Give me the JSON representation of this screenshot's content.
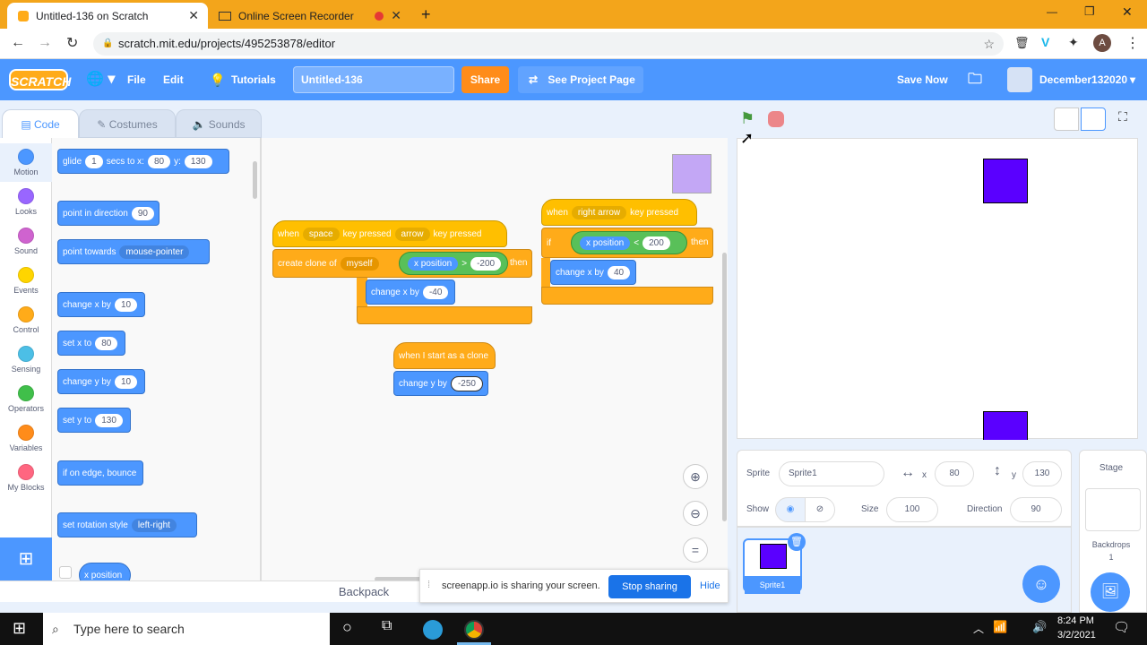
{
  "browser": {
    "tabs": [
      {
        "label": "Untitled-136 on Scratch"
      },
      {
        "label": "Online Screen Recorder"
      }
    ],
    "url": "scratch.mit.edu/projects/495253878/editor",
    "profile_initial": "A"
  },
  "menu": {
    "logo": "SCRATCH",
    "file": "File",
    "edit": "Edit",
    "tutorials": "Tutorials",
    "project_title": "Untitled-136",
    "share": "Share",
    "see_project": "See Project Page",
    "save_now": "Save Now",
    "username": "December132020"
  },
  "tabs": {
    "code": "Code",
    "costumes": "Costumes",
    "sounds": "Sounds"
  },
  "categories": [
    {
      "label": "Motion",
      "color": "#4c97ff"
    },
    {
      "label": "Looks",
      "color": "#9966ff"
    },
    {
      "label": "Sound",
      "color": "#cf63cf"
    },
    {
      "label": "Events",
      "color": "#ffd500"
    },
    {
      "label": "Control",
      "color": "#ffab19"
    },
    {
      "label": "Sensing",
      "color": "#4cbfe6"
    },
    {
      "label": "Operators",
      "color": "#40bf4a"
    },
    {
      "label": "Variables",
      "color": "#ff8c1a"
    },
    {
      "label": "My Blocks",
      "color": "#ff6680"
    }
  ],
  "palette": {
    "glide": {
      "a": "glide",
      "v1": "1",
      "b": "secs to x:",
      "v2": "80",
      "c": "y:",
      "v3": "130"
    },
    "point_dir": {
      "a": "point in direction",
      "v": "90"
    },
    "point_towards": {
      "a": "point towards",
      "v": "mouse-pointer"
    },
    "change_x": {
      "a": "change x by",
      "v": "10"
    },
    "set_x": {
      "a": "set x to",
      "v": "80"
    },
    "change_y": {
      "a": "change y by",
      "v": "10"
    },
    "set_y": {
      "a": "set y to",
      "v": "130"
    },
    "bounce": {
      "a": "if on edge, bounce"
    },
    "rotation": {
      "a": "set rotation style",
      "v": "left-right"
    },
    "xpos": {
      "a": "x position"
    }
  },
  "scripts": {
    "s1_when": "when",
    "s1_key": "space",
    "s1_pressed": "key pressed",
    "s1_clone": "create clone of",
    "s1_myself": "myself",
    "s2_key": "arrow",
    "s2_pressed": "key pressed",
    "s2_xpos": "x position",
    "s2_gt": ">",
    "s2_val": "-200",
    "s2_then": "then",
    "s2_change": "change x by",
    "s2_change_val": "-40",
    "s3_when": "when",
    "s3_key": "right arrow",
    "s3_pressed": "key pressed",
    "s3_if": "if",
    "s3_xpos": "x position",
    "s3_lt": "<",
    "s3_val": "200",
    "s3_then": "then",
    "s3_change": "change x by",
    "s3_change_val": "40",
    "s4_hat": "when I start as a clone",
    "s4_change": "change y by",
    "s4_val": "-250"
  },
  "sprite_info": {
    "sprite_label": "Sprite",
    "sprite_name": "Sprite1",
    "x_label": "x",
    "x_val": "80",
    "y_label": "y",
    "y_val": "130",
    "show_label": "Show",
    "size_label": "Size",
    "size_val": "100",
    "direction_label": "Direction",
    "direction_val": "90"
  },
  "sprite_list": [
    {
      "name": "Sprite1"
    }
  ],
  "stage_pane": {
    "title": "Stage",
    "backdrops": "Backdrops",
    "count": "1"
  },
  "backpack": "Backpack",
  "sharing": {
    "msg": "screenapp.io is sharing your screen.",
    "stop": "Stop sharing",
    "hide": "Hide"
  },
  "taskbar": {
    "search": "Type here to search",
    "time": "8:24 PM",
    "date": "3/2/2021"
  },
  "colors": {
    "sprite": "#5a00ff",
    "accent": "#4c97ff"
  }
}
